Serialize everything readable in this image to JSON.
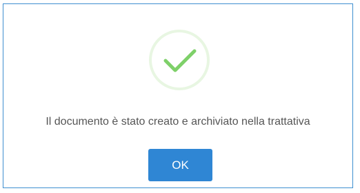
{
  "dialog": {
    "icon": "success-checkmark-icon",
    "message": "Il documento è stato creato e archiviato nella trattativa",
    "ok_label": "OK"
  },
  "colors": {
    "border": "#3d8ed0",
    "check": "#7ed069",
    "icon_ring": "#e8f6e2",
    "button": "#2f86d4",
    "text": "#555555"
  }
}
